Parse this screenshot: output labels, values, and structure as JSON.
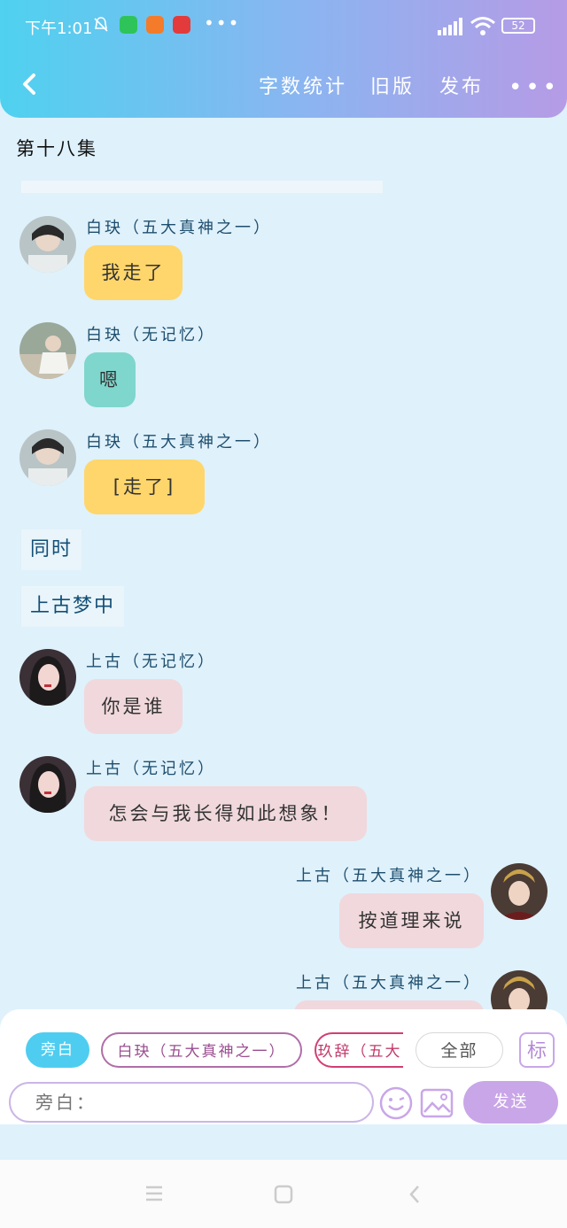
{
  "status_bar": {
    "time": "下午1:01",
    "more_dots": "•••",
    "battery": "52"
  },
  "header": {
    "word_count": "字数统计",
    "old_version": "旧版",
    "publish": "发布",
    "more": "•••"
  },
  "episode_title": "第十八集",
  "messages": [
    {
      "speaker": "白玦（五大真神之一）",
      "text": "我走了"
    },
    {
      "speaker": "白玦（无记忆）",
      "text": "嗯"
    },
    {
      "speaker": "白玦（五大真神之一）",
      "text": "[走了]"
    },
    {
      "narration": "同时"
    },
    {
      "narration": "上古梦中"
    },
    {
      "speaker": "上古（无记忆）",
      "text": "你是谁"
    },
    {
      "speaker": "上古（无记忆）",
      "text": "怎会与我长得如此想象！"
    },
    {
      "speaker": "上古（五大真神之一）",
      "text": "按道理来说"
    },
    {
      "speaker": "上古（五大真神之一）",
      "text": ""
    }
  ],
  "chips": {
    "narration": "旁白",
    "baijue": "白玦（五大真神之一）",
    "jiuci": "玖辞（五大",
    "all": "全部",
    "mark": "标"
  },
  "input": {
    "placeholder": "旁白："
  },
  "send_label": "发送"
}
